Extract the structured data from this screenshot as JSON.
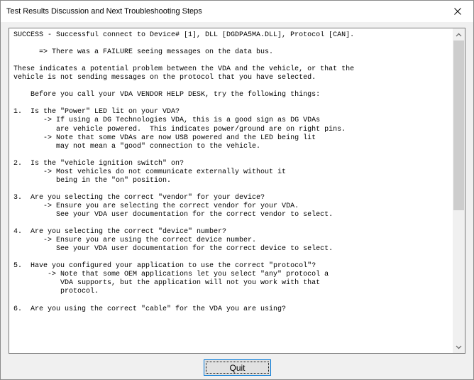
{
  "window": {
    "title": "Test Results Discussion and Next Troubleshooting Steps",
    "close_icon": "close-icon"
  },
  "message": {
    "lines": [
      "SUCCESS - Successful connect to Device# [1], DLL [DGDPA5MA.DLL], Protocol [CAN].",
      "",
      "      => There was a FAILURE seeing messages on the data bus.",
      "",
      "These indicates a potential problem between the VDA and the vehicle, or that the",
      "vehicle is not sending messages on the protocol that you have selected.",
      "",
      "    Before you call your VDA VENDOR HELP DESK, try the following things:",
      "",
      "1.  Is the \"Power\" LED lit on your VDA?",
      "       -> If using a DG Technologies VDA, this is a good sign as DG VDAs",
      "          are vehicle powered.  This indicates power/ground are on right pins.",
      "       -> Note that some VDAs are now USB powered and the LED being lit",
      "          may not mean a \"good\" connection to the vehicle.",
      "",
      "2.  Is the \"vehicle ignition switch\" on?",
      "       -> Most vehicles do not communicate externally without it",
      "          being in the \"on\" position.",
      "",
      "3.  Are you selecting the correct \"vendor\" for your device?",
      "       -> Ensure you are selecting the correct vendor for your VDA.",
      "          See your VDA user documentation for the correct vendor to select.",
      "",
      "4.  Are you selecting the correct \"device\" number?",
      "       -> Ensure you are using the correct device number.",
      "          See your VDA user documentation for the correct device to select.",
      "",
      "5.  Have you configured your application to use the correct \"protocol\"?",
      "        -> Note that some OEM applications let you select \"any\" protocol a",
      "           VDA supports, but the application will not you work with that",
      "           protocol.",
      "",
      "6.  Are you using the correct \"cable\" for the VDA you are using?"
    ]
  },
  "scrollbar": {
    "up_icon": "chevron-up-icon",
    "down_icon": "chevron-down-icon"
  },
  "buttons": {
    "quit_label": "Quit"
  }
}
